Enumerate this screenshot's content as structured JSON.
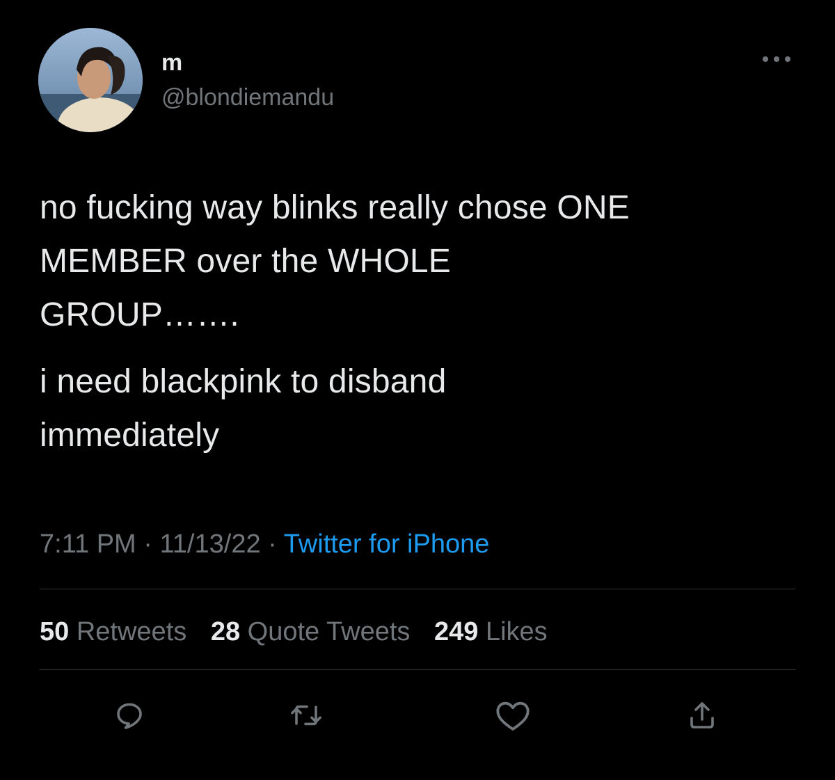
{
  "user": {
    "display_name": "m",
    "handle": "@blondiemandu",
    "avatar": "profile-photo"
  },
  "tweet": {
    "paragraphs": [
      "no fucking way blinks really chose ONE\nMEMBER over the WHOLE\nGROUP…….",
      "i need blackpink to disband\nimmediately"
    ],
    "time": "7:11 PM",
    "separator": "·",
    "date": "11/13/22",
    "source": "Twitter for iPhone"
  },
  "stats": {
    "retweets_count": "50",
    "retweets_label": "Retweets",
    "quotes_count": "28",
    "quotes_label": "Quote Tweets",
    "likes_count": "249",
    "likes_label": "Likes"
  },
  "actions": {
    "reply": "reply-icon",
    "retweet": "retweet-icon",
    "like": "heart-icon",
    "share": "share-icon"
  },
  "colors": {
    "background": "#000000",
    "text_primary": "#e7e9ea",
    "text_secondary": "#71767b",
    "link": "#1d9bf0",
    "divider": "#2f3336"
  }
}
